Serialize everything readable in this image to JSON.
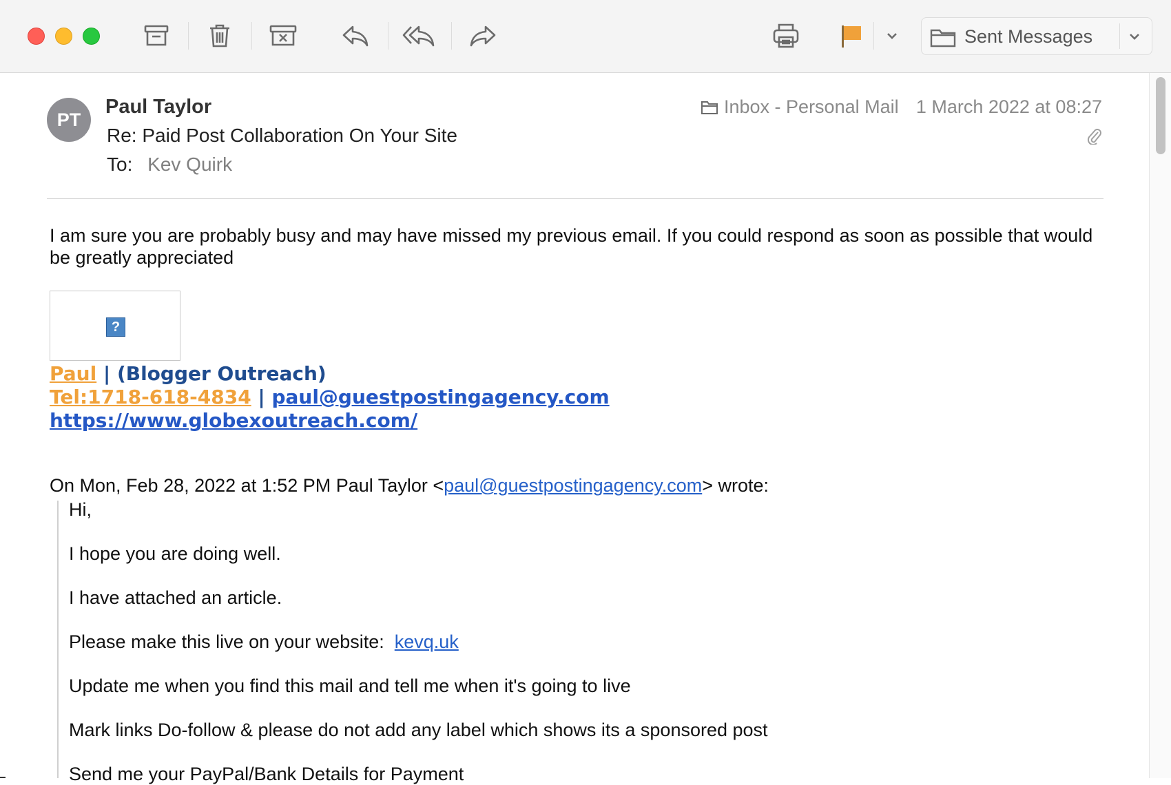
{
  "toolbar": {
    "buttons": [
      "archive-icon",
      "trash-icon",
      "junk-icon",
      "reply-icon",
      "reply-all-icon",
      "forward-icon",
      "print-icon",
      "flag-icon"
    ],
    "flag_color": "#f0a13a",
    "folder_select_label": "Sent Messages"
  },
  "header": {
    "avatar_initials": "PT",
    "sender": "Paul Taylor",
    "subject": "Re: Paid Post Collaboration On Your Site",
    "to_label": "To:",
    "to_name": "Kev Quirk",
    "mailbox": "Inbox - Personal Mail",
    "date": "1 March 2022 at 08:27"
  },
  "body": {
    "paragraph1": "I am sure you are probably busy and may have missed my previous email. If you could respond as soon as possible that would be greatly appreciated",
    "image_placeholder": "?",
    "signature": {
      "name_link": "Paul",
      "separator": "|",
      "role": "(Blogger Outreach)",
      "tel_link": "Tel:1718-618-4834",
      "email_link": "paul@guestpostingagency.com",
      "website_link": "https://www.globexoutreach.com/"
    },
    "quote_intro_prefix": "On Mon, Feb 28, 2022 at 1:52 PM Paul Taylor <",
    "quote_intro_email": "paul@guestpostingagency.com",
    "quote_intro_suffix": "> wrote:",
    "quoted": {
      "greeting": "Hi,",
      "line1": "I hope you are doing well.",
      "line2": "I have attached an article.",
      "line3_prefix": "Please make this live on your website:",
      "line3_link": "kevq.uk",
      "line4": "Update me when you find this mail and tell me when it's going to live",
      "line5": "Mark links Do-follow & please do not add any label which shows its a sponsored post",
      "line6": "Send me your PayPal/Bank Details for Payment"
    }
  }
}
